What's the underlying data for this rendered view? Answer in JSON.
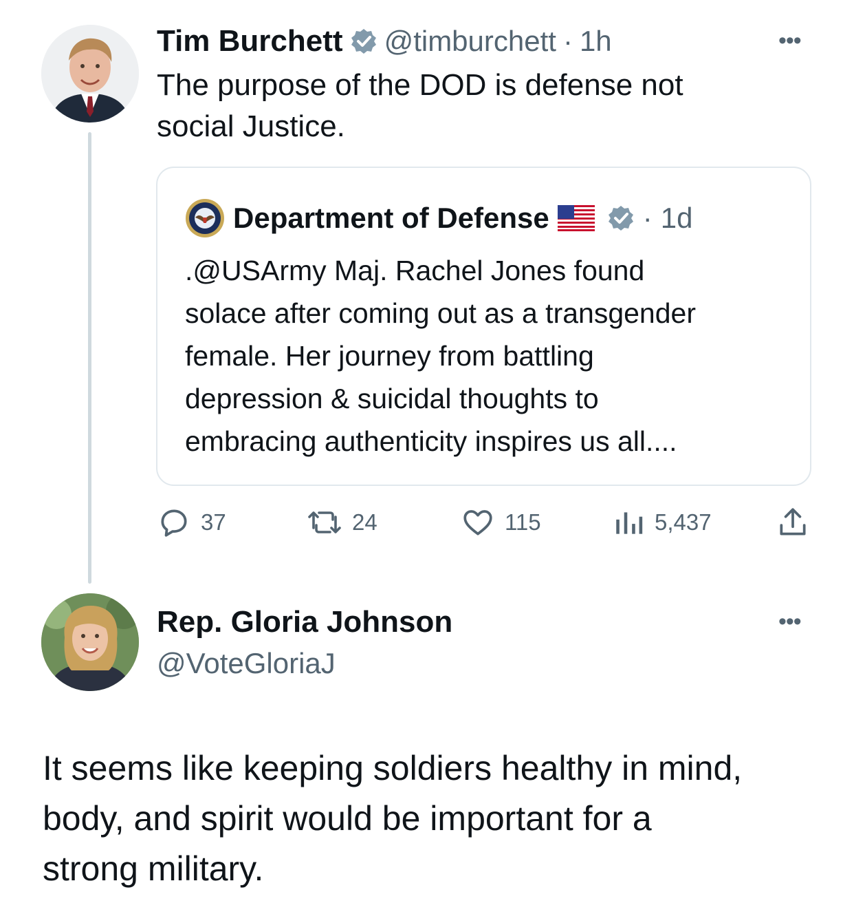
{
  "tweet1": {
    "author_name": "Tim Burchett",
    "author_handle": "@timburchett",
    "separator": "·",
    "time": "1h",
    "more_label": "•••",
    "text_line1": "The purpose of the DOD is defense not",
    "text_line2": "social Justice.",
    "verified": true,
    "avatar_icon": "man-portrait"
  },
  "quoted": {
    "author_name": "Department of Defense",
    "flag_icon": "us-flag-emoji",
    "separator": "·",
    "time": "1d",
    "avatar_icon": "dod-seal",
    "text_lines": [
      ".@USArmy Maj. Rachel Jones found",
      "solace after coming out as a transgender",
      "female. Her journey from battling",
      "depression & suicidal thoughts to",
      "embracing authenticity inspires us all...."
    ]
  },
  "actions": {
    "replies": "37",
    "reposts": "24",
    "likes": "115",
    "views": "5,437"
  },
  "tweet2": {
    "author_name": "Rep. Gloria Johnson",
    "author_handle": "@VoteGloriaJ",
    "more_label": "•••",
    "avatar_icon": "woman-portrait",
    "text_lines": [
      "It seems like keeping soldiers healthy in mind,",
      "body, and spirit would be important for a",
      "strong military."
    ]
  },
  "colors": {
    "text": "#0f1419",
    "muted": "#536471",
    "border": "#e1e8ed",
    "verified_badge": "#829aab"
  }
}
